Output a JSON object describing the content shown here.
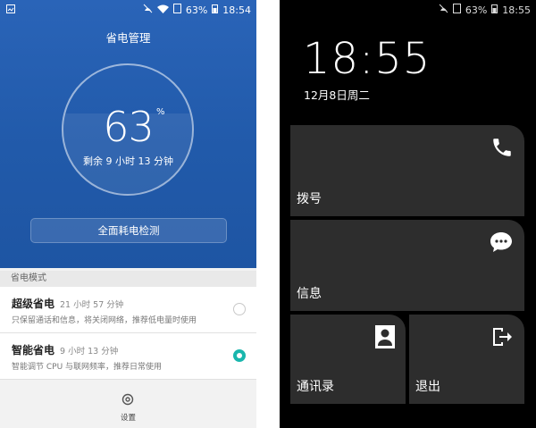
{
  "left": {
    "status": {
      "battery": "63%",
      "time": "18:54"
    },
    "title": "省电管理",
    "battery_percent": "63",
    "percent_symbol": "%",
    "remaining": "剩余 9 小时 13 分钟",
    "scan_button": "全面耗电检测",
    "section_header": "省电模式",
    "modes": [
      {
        "name": "超级省电",
        "duration": "21 小时 57 分钟",
        "desc": "只保留通话和信息，将关闭网络，推荐低电量时使用",
        "selected": false
      },
      {
        "name": "智能省电",
        "duration": "9 小时 13 分钟",
        "desc": "智能调节 CPU 与联网频率，推荐日常使用",
        "selected": true
      }
    ],
    "settings_label": "设置"
  },
  "right": {
    "status": {
      "battery": "63%",
      "time": "18:55"
    },
    "clock": "18:55",
    "date": "12月8日周二",
    "tiles": [
      {
        "label": "拨号",
        "icon": "phone-icon"
      },
      {
        "label": "信息",
        "icon": "message-icon"
      },
      {
        "label": "通讯录",
        "icon": "contacts-icon"
      },
      {
        "label": "退出",
        "icon": "exit-icon"
      }
    ]
  },
  "colors": {
    "blue": "#2a64b8",
    "teal": "#19b6ad",
    "tile": "#2d2d2d"
  }
}
